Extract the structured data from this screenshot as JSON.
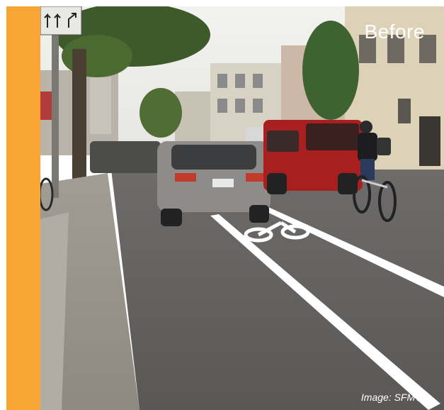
{
  "labels": {
    "before": "Before",
    "credit": "Image: SFMTA"
  },
  "colors": {
    "accent_bar": "#f9a533",
    "overlay_text": "#ffffff"
  },
  "scene": {
    "description_icons": [
      "street-sign",
      "tree",
      "buildings",
      "cars",
      "red-suv",
      "cyclist",
      "bike-lane-symbol"
    ]
  }
}
